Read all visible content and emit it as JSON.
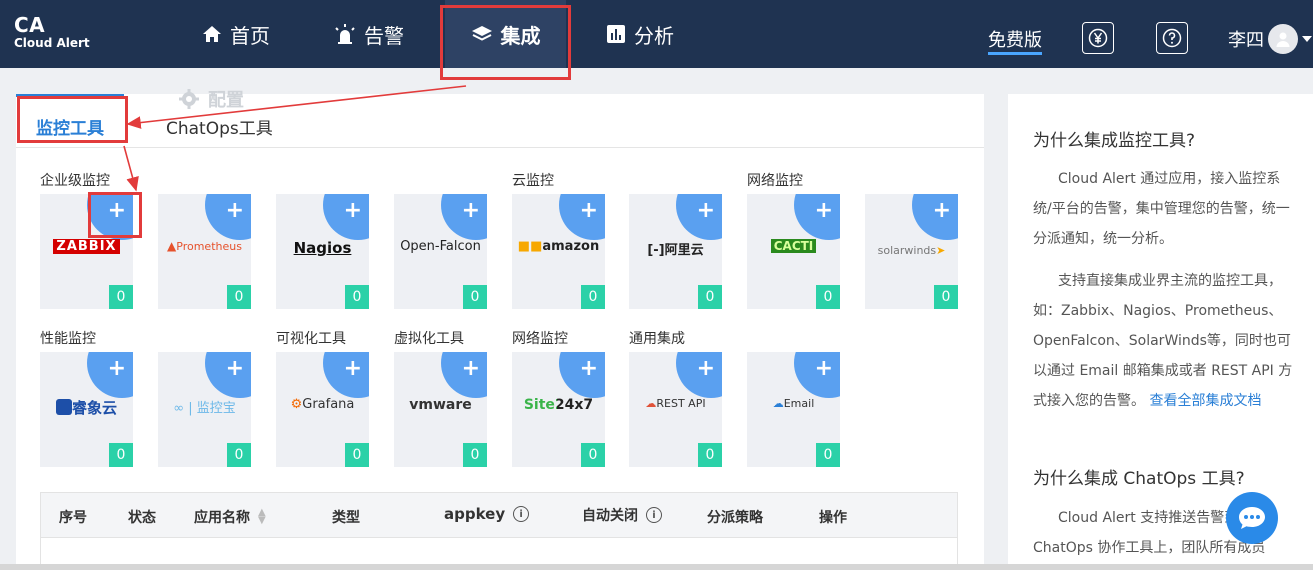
{
  "logo": {
    "title": "CA",
    "subtitle": "Cloud Alert"
  },
  "nav": {
    "items": [
      {
        "label": "首页",
        "icon": "home-icon"
      },
      {
        "label": "告警",
        "icon": "alarm-light-icon"
      },
      {
        "label": "集成",
        "icon": "layers-icon"
      },
      {
        "label": "分析",
        "icon": "bar-chart-icon"
      }
    ],
    "free_label": "免费版",
    "user_name": "李四"
  },
  "tabs": {
    "monitor": "监控工具",
    "chatops": "ChatOps工具",
    "ghost_config": "配置"
  },
  "sections": {
    "enterprise": "企业级监控",
    "cloud": "云监控",
    "network1": "网络监控",
    "performance": "性能监控",
    "visual": "可视化工具",
    "virtual": "虚拟化工具",
    "network2": "网络监控",
    "generic": "通用集成"
  },
  "cards": [
    {
      "brand": "ZABBIX",
      "count": "0",
      "color": "#d40000"
    },
    {
      "brand": "Prometheus",
      "count": "0",
      "color": "#e6522c"
    },
    {
      "brand": "Nagios",
      "count": "0",
      "color": "#111111"
    },
    {
      "brand": "Open-Falcon",
      "count": "0",
      "color": "#222222"
    },
    {
      "brand": "amazon",
      "count": "0",
      "color": "#222222"
    },
    {
      "brand": "阿里云",
      "count": "0",
      "color": "#222222"
    },
    {
      "brand": "CACTI",
      "count": "0",
      "color": "#2a8a1d"
    },
    {
      "brand": "solarwinds",
      "count": "0",
      "color": "#777777"
    },
    {
      "brand": "睿象云",
      "count": "0",
      "color": "#1d4fa8"
    },
    {
      "brand": "监控宝",
      "count": "0",
      "color": "#6cb8e8"
    },
    {
      "brand": "Grafana",
      "count": "0",
      "color": "#333333"
    },
    {
      "brand": "vmware",
      "count": "0",
      "color": "#333333"
    },
    {
      "brand": "Site24x7",
      "count": "0",
      "color": "#333333"
    },
    {
      "brand": "REST API",
      "count": "0",
      "color": "#333333"
    },
    {
      "brand": "Email",
      "count": "0",
      "color": "#333333"
    }
  ],
  "table": {
    "headers": [
      "序号",
      "状态",
      "应用名称",
      "类型",
      "appkey",
      "自动关闭",
      "分派策略",
      "操作"
    ]
  },
  "right": {
    "title1": "为什么集成监控工具?",
    "para1": "Cloud Alert 通过应用，接入监控系统/平台的告警，集中管理您的告警，统一分派通知，统一分析。",
    "para2": "支持直接集成业界主流的监控工具，如：Zabbix、Nagios、Prometheus、OpenFalcon、SolarWinds等，同时也可以通过 Email 邮箱集成或者 REST API 方式接入您的告警。",
    "link": "查看全部集成文档",
    "title2": "为什么集成 ChatOps 工具?",
    "para3": "Cloud Alert 支持推送告警到 ChatOps 协作工具上，团队所有成员"
  },
  "colors": {
    "nav_bg": "#1f3351",
    "accent": "#2a7fd6",
    "count_badge": "#2bd1a8",
    "highlight": "#e23b3b"
  }
}
